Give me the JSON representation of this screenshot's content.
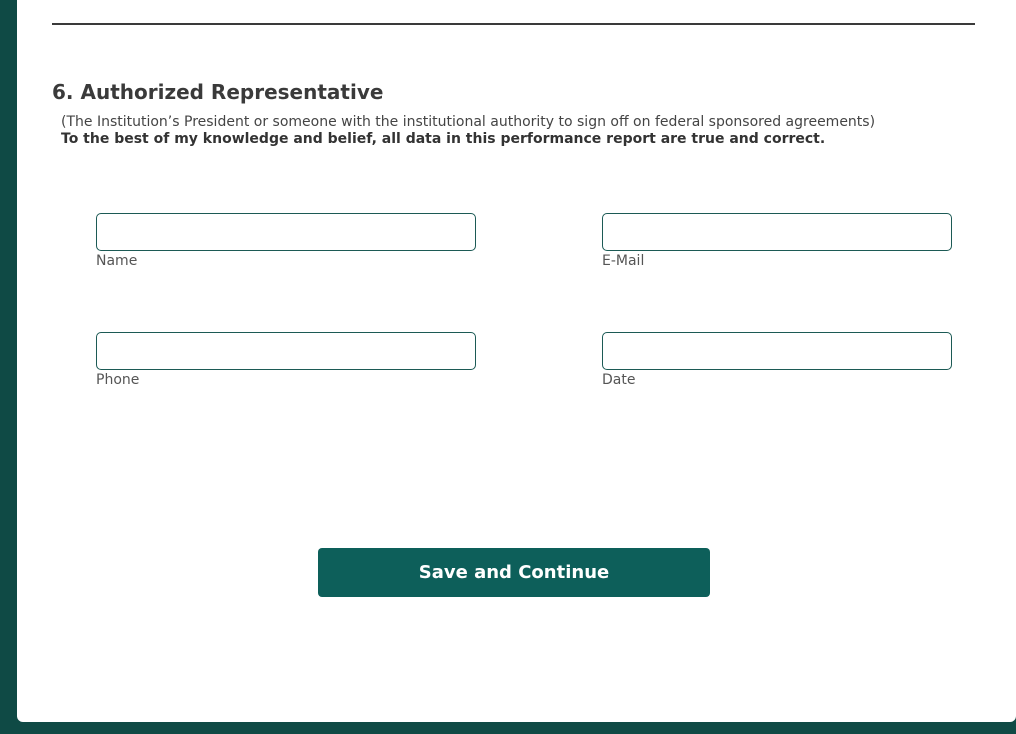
{
  "section": {
    "title": "6. Authorized Representative",
    "note": "(The Institution’s President or someone with the institutional authority to sign off on federal sponsored agreements)",
    "certification": "To the best of my knowledge and belief, all data in this performance report are true and correct."
  },
  "fields": {
    "name": {
      "label": "Name",
      "value": ""
    },
    "email": {
      "label": "E-Mail",
      "value": ""
    },
    "phone": {
      "label": "Phone",
      "value": ""
    },
    "date": {
      "label": "Date",
      "value": ""
    }
  },
  "actions": {
    "save_label": "Save and Continue"
  },
  "colors": {
    "background": "#0f4a45",
    "card": "#ffffff",
    "accent": "#0d5f5a",
    "input_border": "#1c5a55"
  }
}
